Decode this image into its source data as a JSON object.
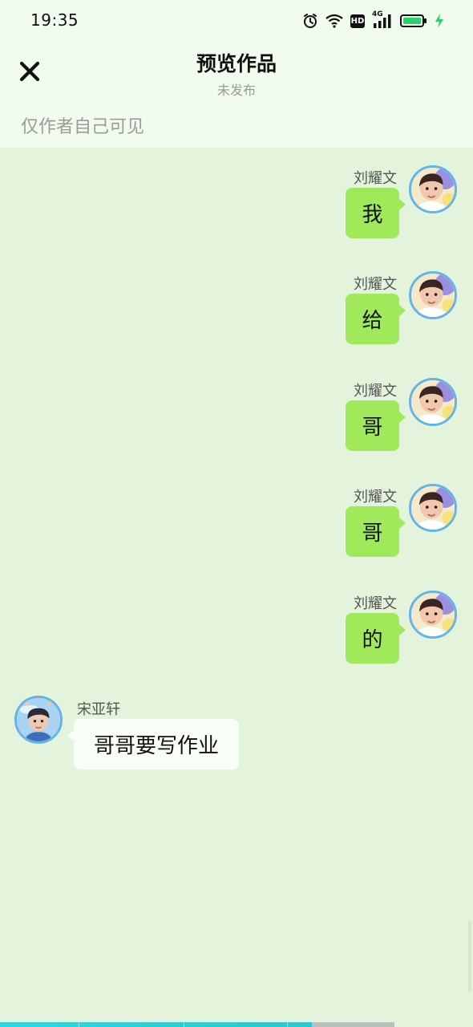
{
  "status_bar": {
    "time": "19:35",
    "icons": [
      "alarm-icon",
      "wifi-icon",
      "hd-icon",
      "signal-4g-icon",
      "battery-icon",
      "charging-icon"
    ],
    "hd_label": "HD",
    "network_label": "4G"
  },
  "header": {
    "close_icon": "close-icon",
    "title": "预览作品",
    "subtitle": "未发布"
  },
  "visibility_note": "仅作者自己可见",
  "messages": [
    {
      "sender": "刘耀文",
      "text": "我",
      "side": "right"
    },
    {
      "sender": "刘耀文",
      "text": "给",
      "side": "right"
    },
    {
      "sender": "刘耀文",
      "text": "哥",
      "side": "right"
    },
    {
      "sender": "刘耀文",
      "text": "哥",
      "side": "right"
    },
    {
      "sender": "刘耀文",
      "text": "的",
      "side": "right"
    },
    {
      "sender": "宋亚轩",
      "text": "哥哥要写作业",
      "side": "left"
    }
  ],
  "progress": {
    "value": 0.79
  },
  "colors": {
    "top_background": "#f1fcef",
    "chat_background": "#e4f4dc",
    "own_bubble": "#a0e95b",
    "other_bubble": "#f8fdf6",
    "avatar_ring": "#62b4e9",
    "progress_fill": "#32d6e0"
  }
}
